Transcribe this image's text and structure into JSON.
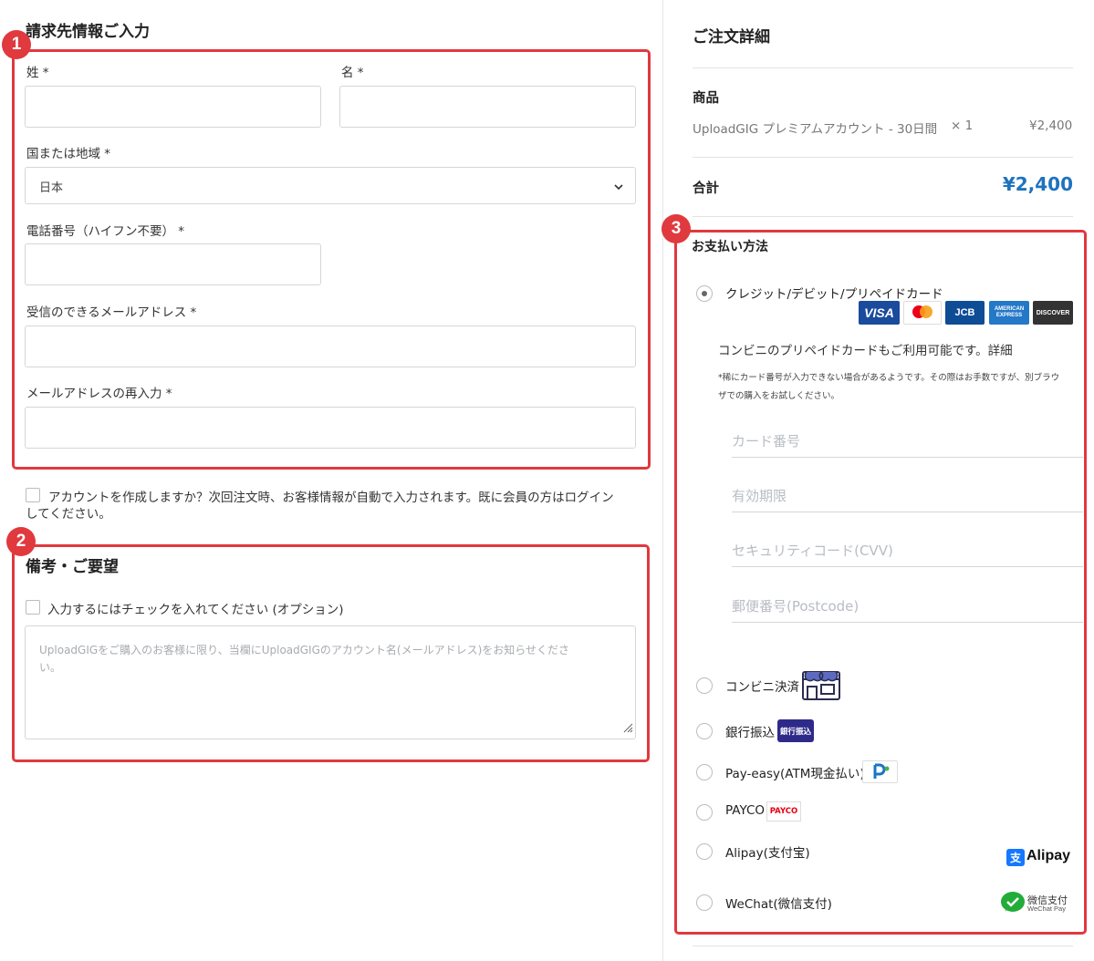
{
  "billing": {
    "title": "請求先情報ご入力",
    "last_name_label": "姓 *",
    "first_name_label": "名 *",
    "country_label": "国または地域 *",
    "country_value": "日本",
    "phone_label": "電話番号（ハイフン不要） *",
    "email_label": "受信のできるメールアドレス *",
    "email_confirm_label": "メールアドレスの再入力 *"
  },
  "account": {
    "create_label_line1": "アカウントを作成しますか？次回注文時、お客様情報が自動で入力されます。既に会員の方はログイン",
    "create_label_line2": "してください。"
  },
  "notes": {
    "title": "備考・ご要望",
    "checkbox_label": "入力するにはチェックを入れてください (オプション)",
    "placeholder_line1": "UploadGIGをご購入のお客様に限り、当欄にUploadGIGのアカウント名(メールアドレス)をお知らせくださ",
    "placeholder_line2": "い。"
  },
  "badges": [
    "1",
    "2",
    "3"
  ],
  "order": {
    "title": "ご注文詳細",
    "product_header": "商品",
    "product_name": "UploadGIG プレミアムアカウント - 30日間",
    "product_qty": "× 1",
    "product_price": "¥2,400",
    "total_label": "合計",
    "total_value": "¥2,400"
  },
  "payment": {
    "title": "お支払い方法",
    "card_option": "クレジット/デビット/プリペイドカード",
    "card_logos": [
      "VISA",
      "mastercard",
      "JCB",
      "AMERICAN EXPRESS",
      "DISCOVER"
    ],
    "card_note": "コンビニのプリペイドカードもご利用可能です。詳細",
    "card_warning_line1": "*稀にカード番号が入力できない場合があるようです。その際はお手数ですが、別ブラウ",
    "card_warning_line2": "ザでの購入をお試しください。",
    "card_number_placeholder": "カード番号",
    "expiry_placeholder": "有効期限",
    "cvv_placeholder": "セキュリティコード(CVV)",
    "postcode_placeholder": "郵便番号(Postcode)",
    "options": [
      {
        "label": "コンビニ決済"
      },
      {
        "label": "銀行振込",
        "logo_text": "銀行振込"
      },
      {
        "label": "Pay-easy(ATM現金払い)"
      },
      {
        "label": "PAYCO",
        "logo_text": "PAYCO"
      },
      {
        "label": "Alipay(支付宝)",
        "logo_text": "Alipay"
      },
      {
        "label": "WeChat(微信支付)",
        "logo_text": "微信支付",
        "logo_sub": "WeChat Pay"
      }
    ]
  },
  "colors": {
    "accent_red": "#e0393e",
    "total_blue": "#1e73be"
  }
}
